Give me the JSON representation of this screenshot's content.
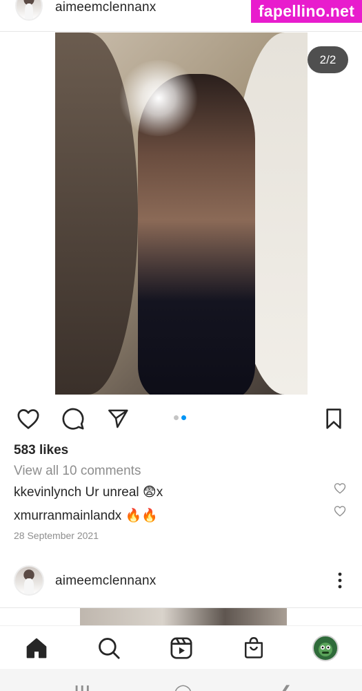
{
  "watermark": {
    "text": "fapellino.net",
    "bg_color": "#e81ccd"
  },
  "post1": {
    "username": "aimeemclennanx",
    "photo_counter": "2/2",
    "carousel": {
      "total": 2,
      "active": 2,
      "active_color": "#0095f6",
      "inactive_color": "#c4c4c4"
    },
    "actions": {
      "like_icon": "heart-icon",
      "comment_icon": "comment-icon",
      "share_icon": "send-icon",
      "save_icon": "bookmark-icon"
    },
    "likes": "583 likes",
    "view_comments": "View all 10 comments",
    "comments": [
      {
        "author": "kkevinlynch",
        "text": " Ur unreal 😨x"
      },
      {
        "author": "xmurranmainlandx",
        "text": " 🔥🔥"
      }
    ],
    "date": "28 September 2021"
  },
  "post2": {
    "username": "aimeemclennanx",
    "more_icon": "more-vertical-icon"
  },
  "bottom_nav": {
    "items": [
      {
        "icon": "home-icon"
      },
      {
        "icon": "search-icon"
      },
      {
        "icon": "reels-icon"
      },
      {
        "icon": "shop-icon"
      },
      {
        "icon": "profile-avatar"
      }
    ]
  },
  "system_nav": {
    "recents": "|||",
    "home": "◯",
    "back": "❮"
  }
}
